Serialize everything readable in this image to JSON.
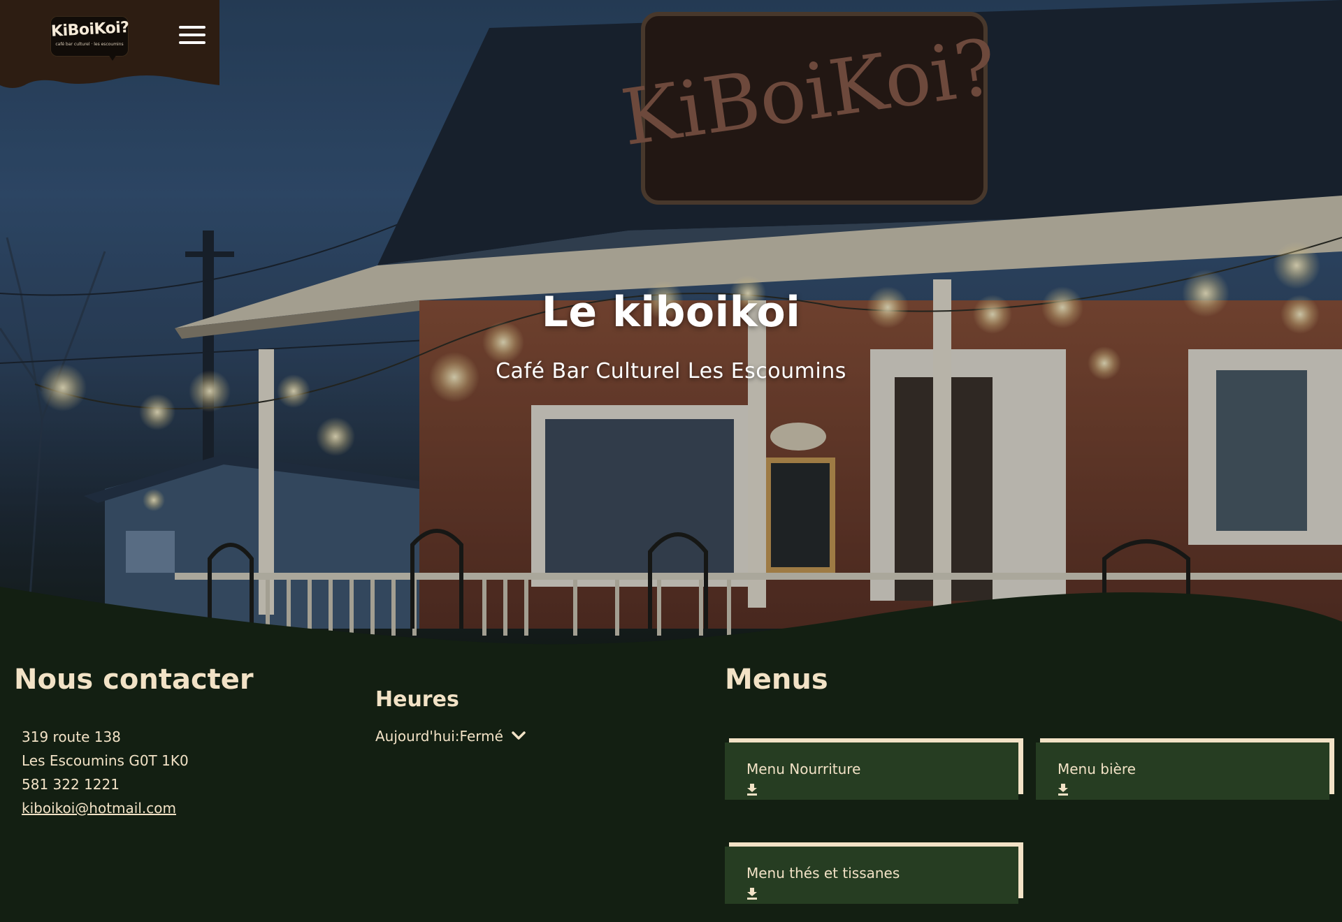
{
  "header": {
    "logo_text": "KiBoiKoi?",
    "logo_tagline": "café bar culturel · les escoumins",
    "menu_toggle_icon": "hamburger-menu-icon"
  },
  "hero": {
    "title": "Le kiboikoi",
    "subtitle": "Café Bar Culturel Les Escoumins",
    "sign_text": "KiBoiKoi?"
  },
  "contact": {
    "heading": "Nous contacter",
    "address_line1": "319 route 138",
    "address_line2": "Les Escoumins G0T 1K0",
    "phone": "581 322 1221",
    "email": "kiboikoi@hotmail.com"
  },
  "hours": {
    "heading": "Heures",
    "today_label": "Aujourd'hui:",
    "today_value": "Fermé",
    "toggle_icon": "chevron-down-icon"
  },
  "menus": {
    "heading": "Menus",
    "items": [
      {
        "label": "Menu Nourriture",
        "icon": "download-icon"
      },
      {
        "label": "Menu bière",
        "icon": "download-icon"
      },
      {
        "label": "Menu thés et tissanes",
        "icon": "download-icon"
      }
    ]
  },
  "colors": {
    "footer_bg": "#131f12",
    "header_tab_bg": "#2d1d12",
    "card_bg": "#263d22",
    "cream": "#f2e2c6",
    "white": "#ffffff"
  }
}
